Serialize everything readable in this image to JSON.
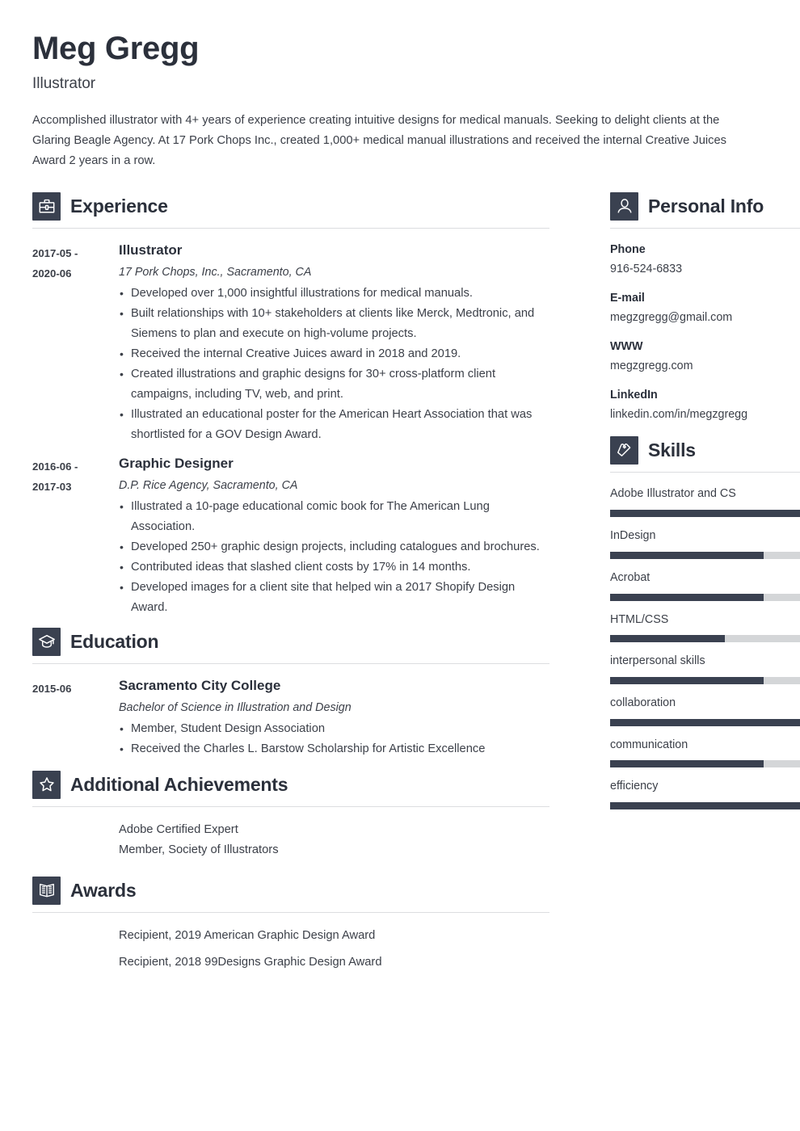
{
  "header": {
    "full_name": "Meg Gregg",
    "job_title": "Illustrator",
    "summary": "Accomplished illustrator with 4+ years of experience creating intuitive designs for medical manuals. Seeking to delight clients at the Glaring Beagle Agency. At 17 Pork Chops Inc., created 1,000+ medical manual illustrations and received the internal Creative Juices Award 2 years in a row."
  },
  "sections": {
    "experience": {
      "title": "Experience",
      "icon": "briefcase-icon",
      "entries": [
        {
          "date_start": "2017-05 -",
          "date_end": "2020-06",
          "role": "Illustrator",
          "org": "17 Pork Chops, Inc., Sacramento, CA",
          "bullets": [
            "Developed over 1,000 insightful illustrations for medical manuals.",
            "Built relationships with 10+ stakeholders at clients like Merck, Medtronic, and Siemens to plan and execute on high-volume projects.",
            "Received the internal Creative Juices award in 2018 and 2019.",
            "Created illustrations and graphic designs for 30+ cross-platform client campaigns, including TV, web, and print.",
            "Illustrated an educational poster for the American Heart Association that was shortlisted for a GOV Design Award."
          ]
        },
        {
          "date_start": "2016-06 -",
          "date_end": "2017-03",
          "role": "Graphic Designer",
          "org": "D.P. Rice Agency, Sacramento, CA",
          "bullets": [
            "Illustrated a 10-page educational comic book for The American Lung Association.",
            "Developed 250+ graphic design projects, including catalogues and brochures.",
            "Contributed ideas that slashed client costs by 17% in 14 months.",
            "Developed images for a client site that helped win a 2017 Shopify Design Award."
          ]
        }
      ]
    },
    "education": {
      "title": "Education",
      "icon": "graduation-cap-icon",
      "entries": [
        {
          "date_start": "2015-06",
          "date_end": "",
          "role": "Sacramento City College",
          "org": "Bachelor of Science in Illustration and Design",
          "bullets": [
            "Member, Student Design Association",
            "Received the Charles L. Barstow Scholarship for Artistic Excellence"
          ]
        }
      ]
    },
    "achievements": {
      "title": "Additional Achievements",
      "icon": "star-icon",
      "items": [
        "Adobe Certified Expert",
        "Member, Society of Illustrators"
      ]
    },
    "awards": {
      "title": "Awards",
      "icon": "open-book-icon",
      "items": [
        "Recipient, 2019 American Graphic Design Award",
        "Recipient, 2018 99Designs Graphic Design Award"
      ]
    }
  },
  "sidebar": {
    "personal_info": {
      "title": "Personal Info",
      "icon": "person-icon",
      "fields": [
        {
          "label": "Phone",
          "value": "916-524-6833"
        },
        {
          "label": "E-mail",
          "value": "megzgregg@gmail.com"
        },
        {
          "label": "WWW",
          "value": "megzgregg.com"
        },
        {
          "label": "LinkedIn",
          "value": "linkedin.com/in/megzgregg"
        }
      ]
    },
    "skills": {
      "title": "Skills",
      "icon": "puzzle-icon",
      "items": [
        {
          "name": "Adobe Illustrator and CS",
          "level": 100
        },
        {
          "name": "InDesign",
          "level": 80
        },
        {
          "name": "Acrobat",
          "level": 80
        },
        {
          "name": "HTML/CSS",
          "level": 60
        },
        {
          "name": "interpersonal skills",
          "level": 80
        },
        {
          "name": "collaboration",
          "level": 100
        },
        {
          "name": "communication",
          "level": 80
        },
        {
          "name": "efficiency",
          "level": 100
        }
      ]
    }
  },
  "theme": {
    "accent": "#3a4150",
    "heading": "#2b303b",
    "text": "#3c4049",
    "rule": "#dcdde0",
    "track": "#d4d6d8"
  }
}
